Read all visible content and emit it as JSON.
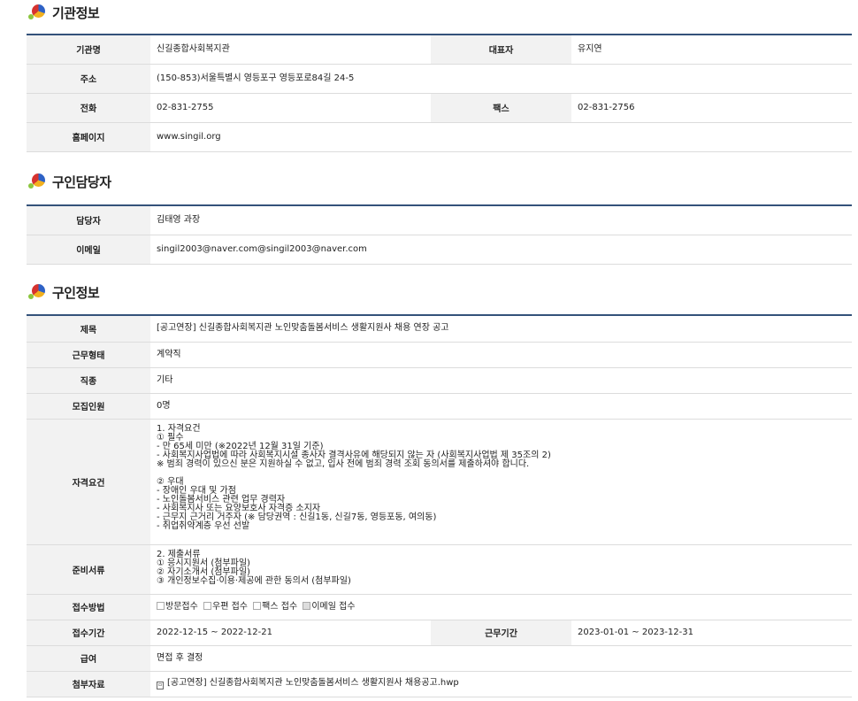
{
  "org": {
    "title": "기관정보",
    "rows": {
      "name_label": "기관명",
      "name": "신길종합사회복지관",
      "rep_label": "대표자",
      "rep": "유지연",
      "addr_label": "주소",
      "addr": "(150-853)서울특별시 영등포구 영등포로84길 24-5",
      "phone_label": "전화",
      "phone": "02-831-2755",
      "fax_label": "팩스",
      "fax": "02-831-2756",
      "home_label": "홈페이지",
      "home": "www.singil.org"
    }
  },
  "contact": {
    "title": "구인담당자",
    "person_label": "담당자",
    "person": "김태영 과장",
    "email_label": "이메일",
    "email": "singil2003@naver.com@singil2003@naver.com"
  },
  "job": {
    "title": "구인정보",
    "subject_label": "제목",
    "subject": "[공고연장] 신길종합사회복지관 노인맞춤돌봄서비스 생활지원사 채용 연장 공고",
    "type_label": "근무형태",
    "type": "계약직",
    "category_label": "직종",
    "category": "기타",
    "count_label": "모집인원",
    "count": "0명",
    "qual_label": "자격요건",
    "qual_lines": [
      "1. 자격요건",
      "① 필수",
      "- 만 65세 미만 (※2022년 12월 31일 기준)",
      "- 사회복지사업법에 따라 사회복지시설 종사자 결격사유에 해당되지 않는 자 (사회복지사업법 제 35조의 2)",
      " ※ 범죄 경력이 있으신 분은 지원하실 수 없고, 입사 전에 범죄 경력 조회 동의서를 제출하셔야 합니다."
    ],
    "qual_lines2": [
      "② 우대",
      "- 장애인 우대 및 가점",
      "- 노인돌봄서비스 관련 업무 경력자",
      "- 사회복지사 또는 요양보호사 자격증 소지자",
      "- 근무지 근거리 거주자 (※ 담당권역 : 신길1동, 신길7동, 영등포동, 여의동)",
      "- 취업취약계층 우선 선발"
    ],
    "docs_label": "준비서류",
    "docs_lines": [
      "2. 제출서류",
      "① 응시지원서 (첨부파일)",
      "② 자기소개서 (첨부파일)",
      "③ 개인정보수집·이용·제공에 관한 동의서 (첨부파일)"
    ],
    "method_label": "접수방법",
    "methods": [
      {
        "label": "방문접수",
        "checked": false
      },
      {
        "label": "우편 접수",
        "checked": false
      },
      {
        "label": "팩스 접수",
        "checked": false
      },
      {
        "label": "이메일 접수",
        "checked": true
      }
    ],
    "period_label": "접수기간",
    "period": "2022-12-15 ~ 2022-12-21",
    "work_period_label": "근무기간",
    "work_period": "2023-01-01 ~ 2023-12-31",
    "pay_label": "급여",
    "pay": "면접 후 결정",
    "attach_label": "첨부자료",
    "attach": "[공고연장] 신길종합사회복지관 노인맞춤돌봄서비스 생활지원사 채용공고.hwp"
  }
}
